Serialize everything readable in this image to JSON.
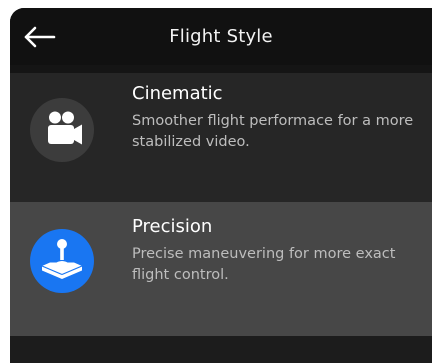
{
  "header": {
    "title": "Flight Style",
    "back_icon": "arrow-left-icon"
  },
  "options": [
    {
      "title": "Cinematic",
      "description": "Smoother flight performace for a more stabilized video.",
      "icon": "video-camera-icon",
      "selected": false,
      "icon_bg": "#3c3c3c"
    },
    {
      "title": "Precision",
      "description": "Precise maneuvering for more exact flight control.",
      "icon": "joystick-icon",
      "selected": true,
      "icon_bg": "#1976f2"
    }
  ],
  "colors": {
    "background": "#151515",
    "selected_row": "#474747",
    "unselected_row": "#262626",
    "accent": "#1976f2"
  }
}
